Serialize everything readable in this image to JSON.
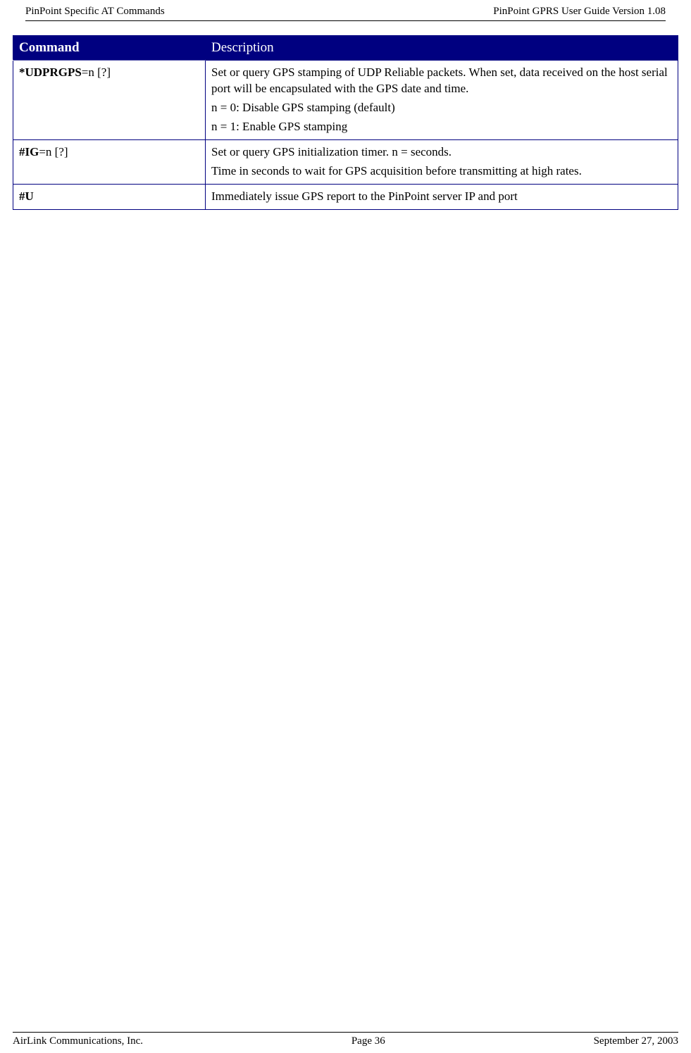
{
  "header": {
    "left": "PinPoint Specific AT Commands",
    "right": "PinPoint GPRS User Guide Version 1.08"
  },
  "table": {
    "columns": {
      "command": "Command",
      "description": "Description"
    },
    "rows": [
      {
        "command_bold": "*UDPRGPS",
        "command_rest": "=n [?]",
        "description": [
          "Set or query GPS stamping of UDP Reliable packets. When set, data received on the host serial port will be encapsulated with the GPS date and time.",
          "n = 0: Disable GPS stamping (default)",
          "n = 1: Enable GPS stamping"
        ]
      },
      {
        "command_bold": "#IG",
        "command_rest": "=n [?]",
        "description": [
          "Set or query GPS initialization timer. n = seconds.",
          "Time in seconds to wait for GPS acquisition before transmitting at high rates."
        ]
      },
      {
        "command_bold": "#U",
        "command_rest": "",
        "description": [
          "Immediately issue GPS report to the PinPoint server IP and port"
        ]
      }
    ]
  },
  "footer": {
    "left": "AirLink Communications, Inc.",
    "center": "Page 36",
    "right": "September 27, 2003"
  }
}
